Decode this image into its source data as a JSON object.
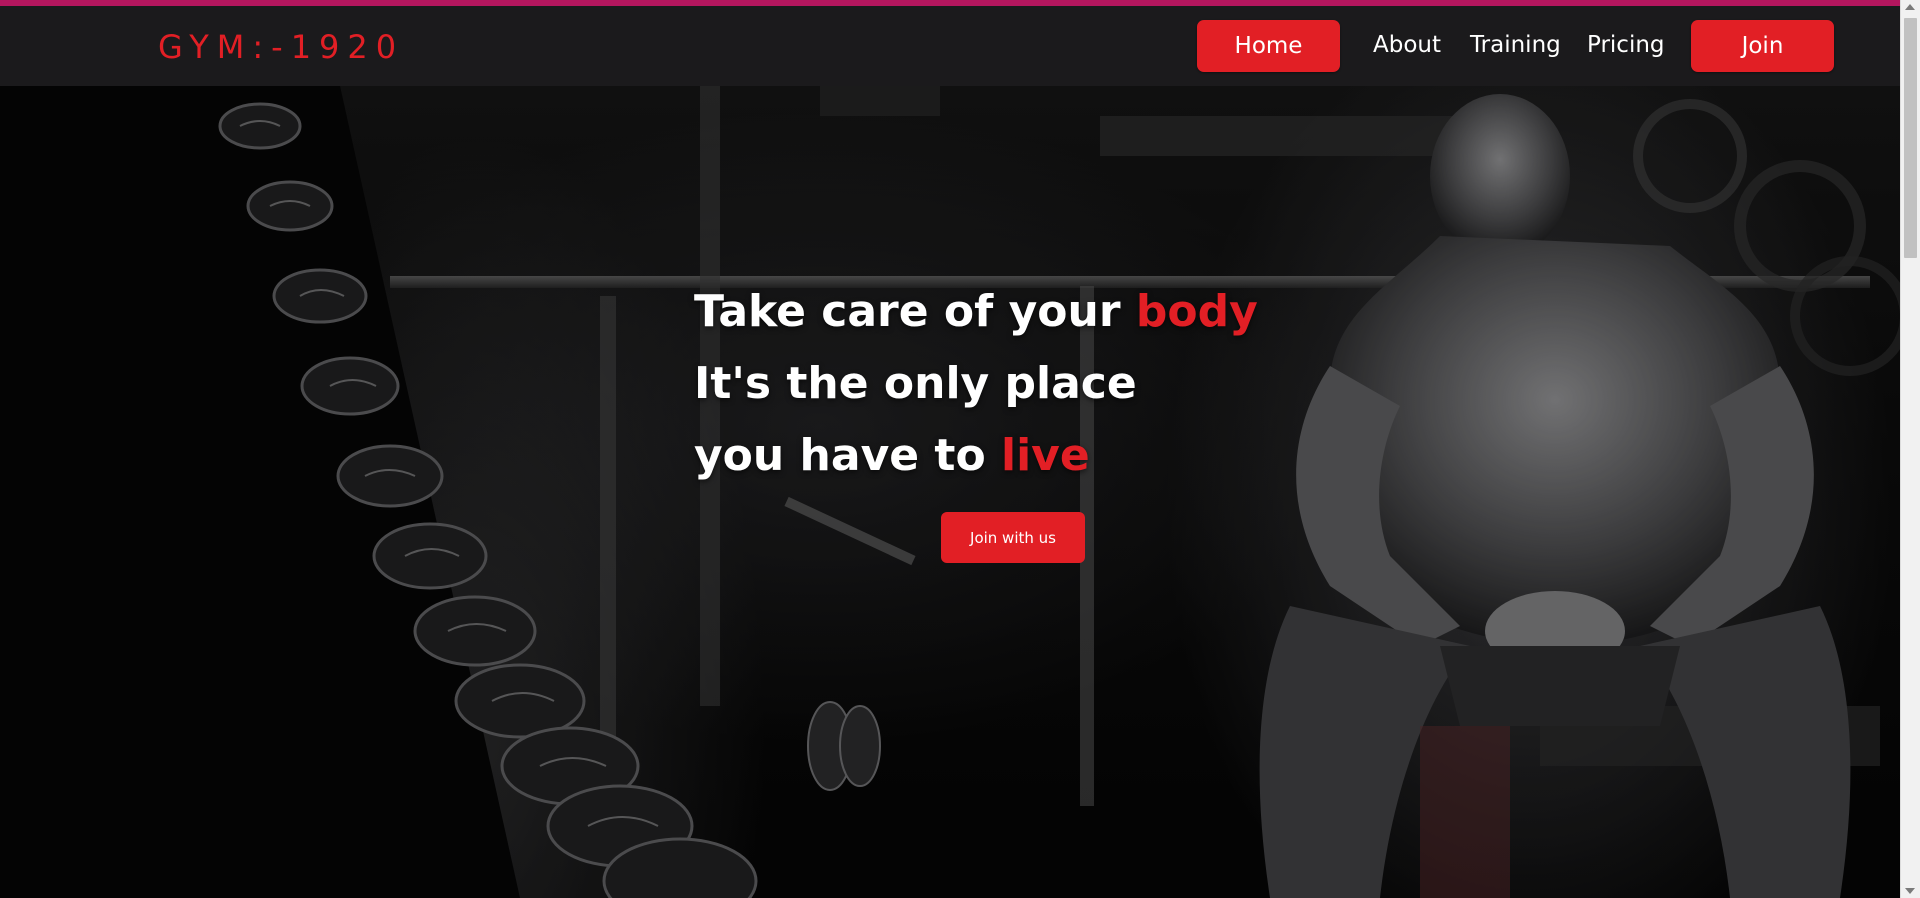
{
  "brand": "GYM:-1920",
  "nav": {
    "home": "Home",
    "about": "About",
    "training": "Training",
    "pricing": "Pricing",
    "join": "Join"
  },
  "hero": {
    "line1": "Take care of your ",
    "line1_accent": "body",
    "line2": "It's the only place",
    "line3": "you have to ",
    "line3_accent": "live",
    "cta": "Join with us"
  },
  "colors": {
    "accent": "#e21f25",
    "navbar": "#1b1a1c",
    "top_strip": "#b4165e"
  }
}
